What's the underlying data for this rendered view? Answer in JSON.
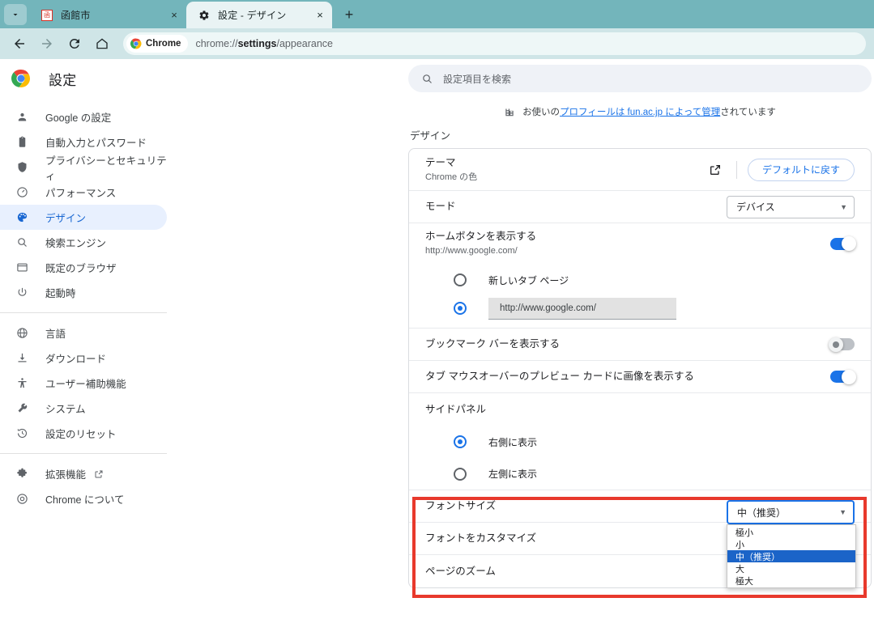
{
  "browser": {
    "tabs": [
      {
        "title": "函館市",
        "favicon": "hakodate-favicon",
        "active": false,
        "close_label": "×"
      },
      {
        "title": "設定 - デザイン",
        "favicon": "gear-icon",
        "active": true,
        "close_label": "×"
      }
    ],
    "newtab_label": "+",
    "toolbar": {
      "back_label": "←",
      "forward_label": "→",
      "reload_label": "⟳",
      "home_label": "⌂",
      "chip_label": "Chrome",
      "url_prefix": "chrome://",
      "url_bold": "settings",
      "url_suffix": "/appearance"
    }
  },
  "sidebar": {
    "title": "設定",
    "items": [
      {
        "label": "Google の設定",
        "icon": "person-icon"
      },
      {
        "label": "自動入力とパスワード",
        "icon": "clipboard-icon"
      },
      {
        "label": "プライバシーとセキュリティ",
        "icon": "shield-icon"
      },
      {
        "label": "パフォーマンス",
        "icon": "speedometer-icon"
      },
      {
        "label": "デザイン",
        "icon": "palette-icon"
      },
      {
        "label": "検索エンジン",
        "icon": "search-icon"
      },
      {
        "label": "既定のブラウザ",
        "icon": "window-icon"
      },
      {
        "label": "起動時",
        "icon": "power-icon"
      }
    ],
    "items2": [
      {
        "label": "言語",
        "icon": "globe-icon"
      },
      {
        "label": "ダウンロード",
        "icon": "download-icon"
      },
      {
        "label": "ユーザー補助機能",
        "icon": "accessibility-icon"
      },
      {
        "label": "システム",
        "icon": "wrench-icon"
      },
      {
        "label": "設定のリセット",
        "icon": "history-icon"
      }
    ],
    "items3": [
      {
        "label": "拡張機能",
        "icon": "puzzle-icon",
        "external": true
      },
      {
        "label": "Chrome について",
        "icon": "chrome-icon",
        "external": false
      }
    ]
  },
  "search": {
    "placeholder": "設定項目を検索",
    "icon": "search-icon"
  },
  "managed": {
    "icon": "building-icon",
    "prefix": "お使いの",
    "link": "プロフィールは fun.ac.jp によって管理",
    "suffix": "されています"
  },
  "main": {
    "section_title": "デザイン",
    "theme": {
      "label": "テーマ",
      "sublabel": "Chrome の色",
      "external_icon": "external-link-icon",
      "reset_button": "デフォルトに戻す"
    },
    "mode": {
      "label": "モード",
      "value": "デバイス"
    },
    "home_button": {
      "label": "ホームボタンを表示する",
      "sublabel": "http://www.google.com/",
      "toggle": "on",
      "option_newtab": "新しいタブ ページ",
      "option_url_value": "http://www.google.com/"
    },
    "bookmarks_bar": {
      "label": "ブックマーク バーを表示する",
      "toggle": "off"
    },
    "tab_preview": {
      "label": "タブ マウスオーバーのプレビュー カードに画像を表示する",
      "toggle": "on"
    },
    "side_panel": {
      "label": "サイドパネル",
      "option_right": "右側に表示",
      "option_left": "左側に表示"
    },
    "font_size": {
      "label": "フォントサイズ",
      "value": "中（推奨）",
      "options": [
        "極小",
        "小",
        "中（推奨）",
        "大",
        "極大"
      ],
      "selected_index": 2
    },
    "customize_fonts": {
      "label": "フォントをカスタマイズ"
    },
    "page_zoom": {
      "label": "ページのズーム"
    }
  },
  "colors": {
    "tabstrip": "#73b5bb",
    "toolbar": "#cfe5e7",
    "accent": "#1a73e8",
    "highlight_box": "#e8392c",
    "dropdown_highlight": "#1b64c8"
  }
}
